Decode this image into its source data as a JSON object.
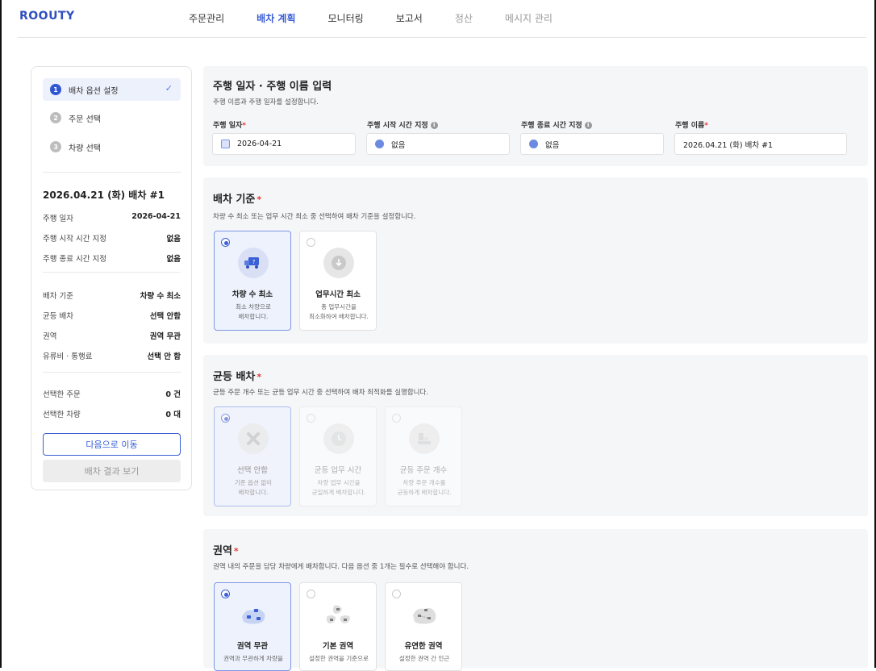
{
  "app": {
    "logo": "ROOUTY"
  },
  "nav": {
    "items": [
      {
        "label": "주문관리",
        "state": "normal"
      },
      {
        "label": "배차 계획",
        "state": "active"
      },
      {
        "label": "모니터링",
        "state": "normal"
      },
      {
        "label": "보고서",
        "state": "normal"
      },
      {
        "label": "정산",
        "state": "dim"
      },
      {
        "label": "메시지 관리",
        "state": "dim"
      }
    ]
  },
  "sidebar": {
    "steps": [
      {
        "num": "1",
        "label": "배차 옵션 설정",
        "active": true,
        "check": "✓"
      },
      {
        "num": "2",
        "label": "주문 선택",
        "active": false
      },
      {
        "num": "3",
        "label": "차량 선택",
        "active": false
      }
    ],
    "summary_title": "2026.04.21 (화) 배차 #1",
    "summary_rows": [
      {
        "k": "주행 일자",
        "v": "2026-04-21"
      },
      {
        "k": "주행 시작 시간 지정",
        "v": "없음"
      },
      {
        "k": "주행 종료 시간 지정",
        "v": "없음"
      },
      {
        "k": "배차 기준",
        "v": "차량 수 최소"
      },
      {
        "k": "균등 배차",
        "v": "선택 안함"
      },
      {
        "k": "권역",
        "v": "권역 무관"
      },
      {
        "k": "유류비 · 통행료",
        "v": "선택 안 함"
      },
      {
        "k": "선택한 주문",
        "v": "0 건"
      },
      {
        "k": "선택한 차량",
        "v": "0 대"
      }
    ],
    "next_button": "다음으로 이동",
    "result_button": "배차 결과 보기"
  },
  "drive": {
    "title": "주행 일자 · 주행 이름 입력",
    "desc": "주행 이름과 주행 일자를 설정합니다.",
    "fields": [
      {
        "label": "주행 일자",
        "required": true,
        "info": false,
        "value": "2026-04-21",
        "icon": "calendar-icon"
      },
      {
        "label": "주행 시작 시간 지정",
        "required": false,
        "info": true,
        "value": "없음",
        "icon": "clock-icon"
      },
      {
        "label": "주행 종료 시간 지정",
        "required": false,
        "info": true,
        "value": "없음",
        "icon": "clock-icon"
      },
      {
        "label": "주행 이름",
        "required": true,
        "info": false,
        "value": "2026.04.21 (화) 배차 #1",
        "icon": ""
      }
    ]
  },
  "criteria": {
    "title": "배차 기준",
    "desc": "차량 수 최소 또는 업무 시간 최소 중 선택하여 배차 기준을 설정합니다.",
    "options": [
      {
        "title": "차량 수 최소",
        "desc1": "최소 차량으로",
        "desc2": "배차합니다.",
        "selected": true,
        "icon": "truck-question-icon"
      },
      {
        "title": "업무시간 최소",
        "desc1": "총 업무시간을",
        "desc2": "최소화하여 배차합니다.",
        "selected": false,
        "icon": "clock-down-icon"
      }
    ]
  },
  "balance": {
    "title": "균등 배차",
    "desc": "균등 주문 개수 또는 균등 업무 시간 중 선택하여 배차 최적화를 실행합니다.",
    "options": [
      {
        "title": "선택 안함",
        "desc1": "기준 옵션 없이",
        "desc2": "배차합니다.",
        "selected": true,
        "icon": "x-mark-icon"
      },
      {
        "title": "균등 업무 시간",
        "desc1": "차량 업무 시간을",
        "desc2": "균일하게 배차합니다.",
        "selected": false,
        "icon": "clock-icon"
      },
      {
        "title": "균등 주문 개수",
        "desc1": "차량 주문 개수를",
        "desc2": "균등하게 배차합니다.",
        "selected": false,
        "icon": "boxes-icon"
      }
    ]
  },
  "region": {
    "title": "권역",
    "desc": "권역 내의 주문을 담당 차량에게 배차합니다. 다음 옵션 중 1개는 필수로 선택해야 합니다.",
    "options": [
      {
        "title": "권역 무관",
        "desc1": "권역과 무관하게 차량을",
        "selected": true,
        "icon": "region-any-icon"
      },
      {
        "title": "기본 권역",
        "desc1": "설정한 권역을 기준으로",
        "selected": false,
        "icon": "region-basic-icon"
      },
      {
        "title": "유연한 권역",
        "desc1": "설정한 권역 간 인근",
        "selected": false,
        "icon": "region-flex-icon"
      }
    ]
  }
}
